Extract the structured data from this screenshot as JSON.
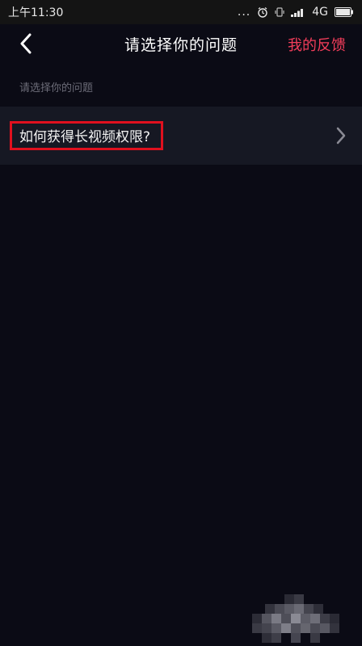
{
  "status_bar": {
    "time": "上午11:30",
    "dots": "...",
    "network": "4G"
  },
  "header": {
    "title": "请选择你的问题",
    "feedback_label": "我的反馈"
  },
  "section": {
    "label": "请选择你的问题"
  },
  "questions": [
    {
      "label": "如何获得长视频权限?"
    }
  ],
  "colors": {
    "background": "#0b0b15",
    "row": "#161823",
    "accent": "#f23d5a",
    "highlight": "#e0101e"
  },
  "icons": {
    "back": "chevron-left-icon",
    "row_arrow": "chevron-right-icon",
    "alarm": "alarm-icon",
    "vibrate": "vibrate-icon",
    "signal": "signal-icon",
    "battery": "battery-icon"
  }
}
